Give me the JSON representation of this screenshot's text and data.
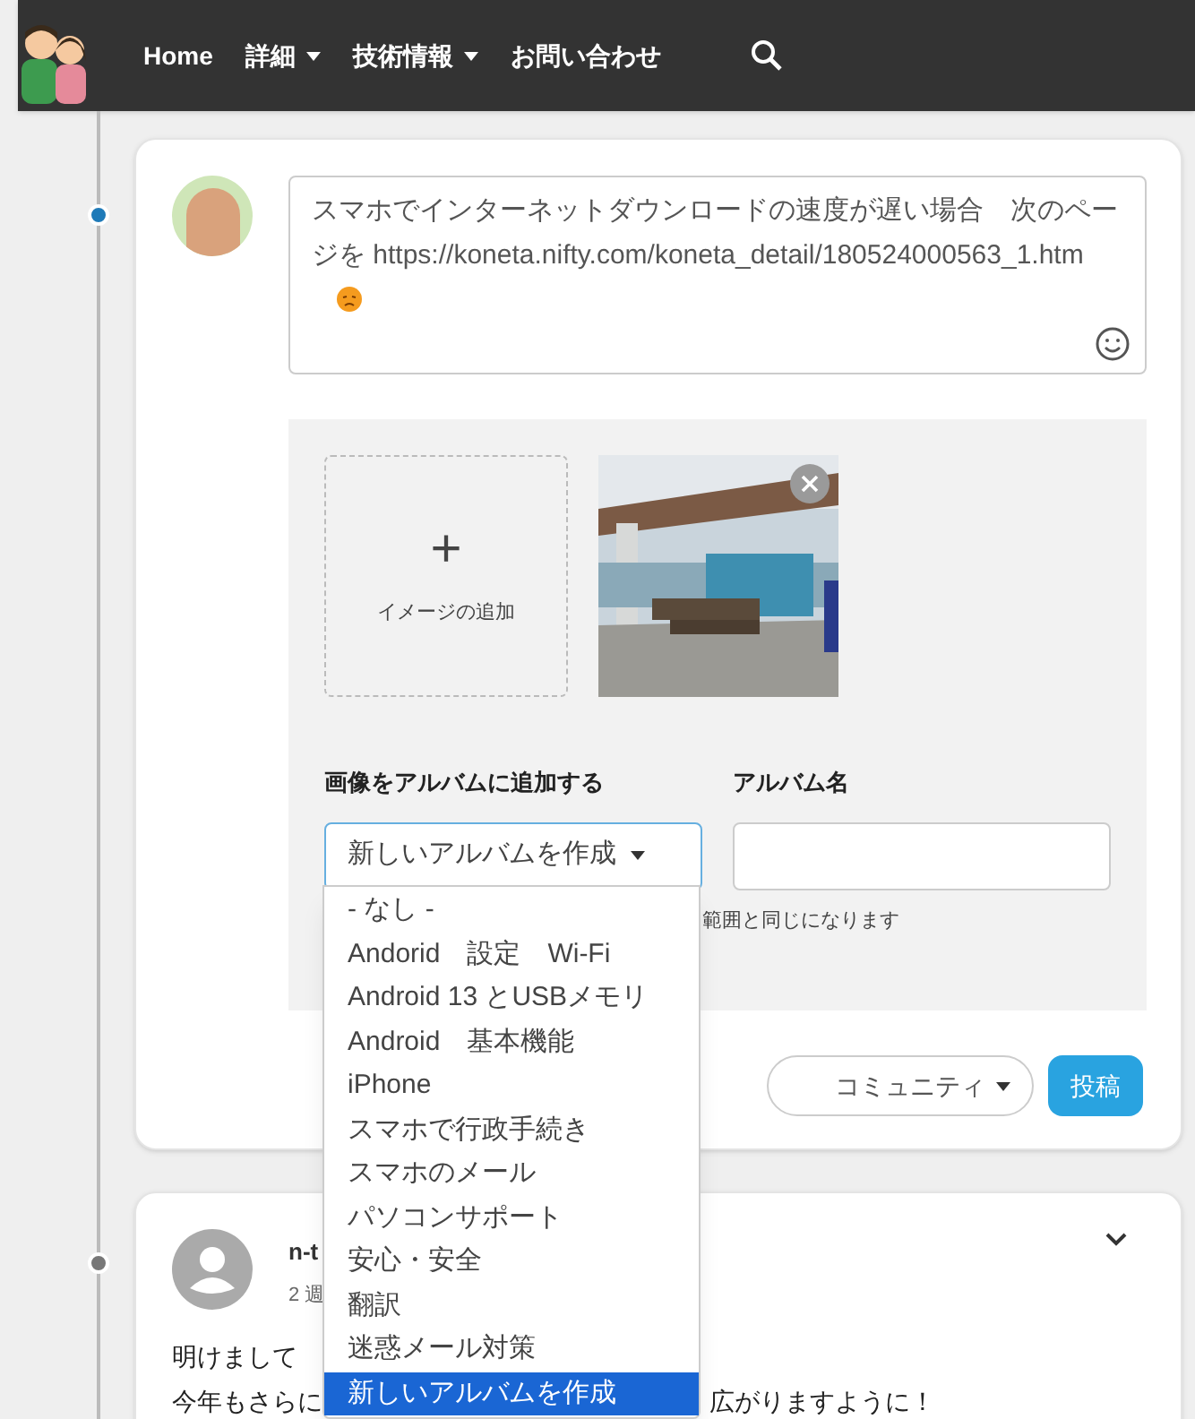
{
  "nav": {
    "items": [
      {
        "label": "Home",
        "dropdown": false
      },
      {
        "label": "詳細",
        "dropdown": true
      },
      {
        "label": "技術情報",
        "dropdown": true
      },
      {
        "label": "お問い合わせ",
        "dropdown": false
      }
    ]
  },
  "composer": {
    "text": "スマホでインターネットダウンロードの速度が遅い場合　次のページを https://koneta.nifty.com/koneta_detail/180524000563_1.htm",
    "add_image_label": "イメージの追加",
    "add_image_symbol": "+",
    "album_select_label": "画像をアルバムに追加する",
    "album_name_label": "アルバム名",
    "album_select_value": "新しいアルバムを作成",
    "hint": "範囲と同じになります",
    "dropdown_options": [
      {
        "label": "- なし -",
        "selected": false
      },
      {
        "label": "Andorid　設定　Wi-Fi",
        "selected": false
      },
      {
        "label": "Android 13 とUSBメモリ",
        "selected": false
      },
      {
        "label": "Android　基本機能",
        "selected": false
      },
      {
        "label": "iPhone",
        "selected": false
      },
      {
        "label": "スマホで行政手続き",
        "selected": false
      },
      {
        "label": "スマホのメール",
        "selected": false
      },
      {
        "label": "パソコンサポート",
        "selected": false
      },
      {
        "label": "安心・安全",
        "selected": false
      },
      {
        "label": "翻訳",
        "selected": false
      },
      {
        "label": "迷惑メール対策",
        "selected": false
      },
      {
        "label": "新しいアルバムを作成",
        "selected": true
      }
    ],
    "scope_select": "コミュニティ",
    "post_button": "投稿"
  },
  "post": {
    "author": "n-t",
    "time": "2 週",
    "lines": [
      [
        "明けまして"
      ],
      [
        "今年もさらに",
        "広がりますように！"
      ]
    ]
  }
}
